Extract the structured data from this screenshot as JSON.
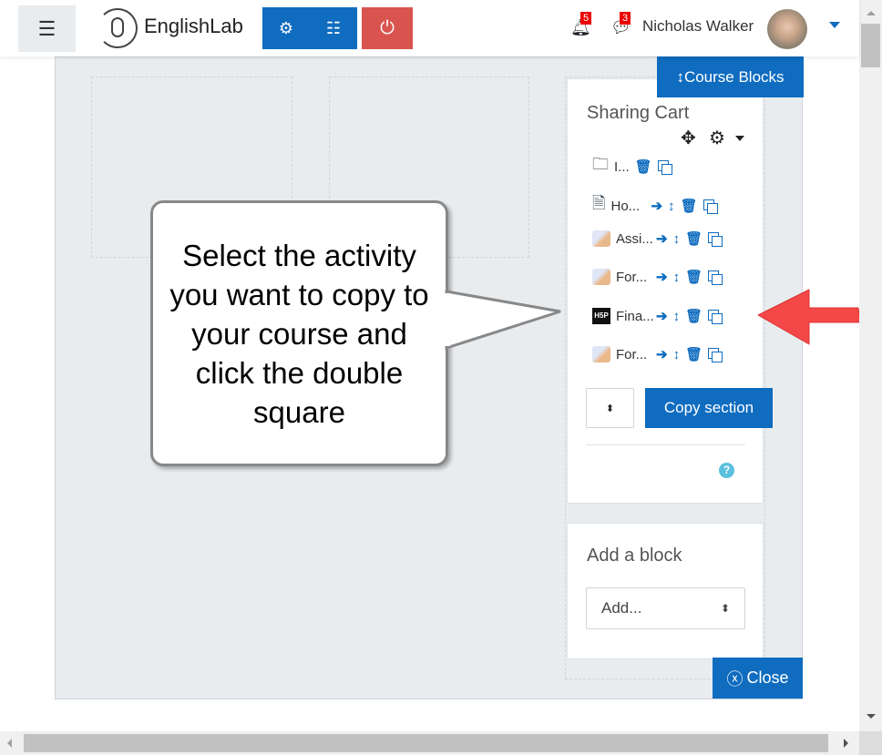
{
  "nav": {
    "brand": "EnglishLab",
    "notifications_count": "5",
    "messages_count": "3",
    "user_name": "Nicholas Walker"
  },
  "course_blocks_label": "Course Blocks",
  "sharing_cart": {
    "title": "Sharing Cart",
    "items": [
      {
        "label": "I...",
        "icon": "folder-icon",
        "actions": [
          "delete",
          "copy"
        ]
      },
      {
        "label": "Ho...",
        "icon": "page-icon",
        "actions": [
          "move-right",
          "move",
          "delete",
          "copy"
        ]
      },
      {
        "label": "Assi...",
        "icon": "assignment-icon",
        "actions": [
          "move-right",
          "move",
          "delete",
          "copy"
        ]
      },
      {
        "label": "For...",
        "icon": "assignment-icon",
        "actions": [
          "move-right",
          "move",
          "delete",
          "copy"
        ]
      },
      {
        "label": "Fina...",
        "icon": "h5p-icon",
        "actions": [
          "move-right",
          "move",
          "delete",
          "copy"
        ]
      },
      {
        "label": "For...",
        "icon": "assignment-icon",
        "actions": [
          "move-right",
          "move",
          "delete",
          "copy"
        ]
      }
    ],
    "copy_section_label": "Copy section",
    "h5p_text": "H5P"
  },
  "add_block": {
    "title": "Add a block",
    "select_value": "Add..."
  },
  "close_label": "Close",
  "callout": {
    "text": "Select the activity you want to copy to your course and click the double square"
  },
  "colors": {
    "primary": "#0f6cbf",
    "danger": "#d9534f",
    "arrow": "#f44848"
  }
}
